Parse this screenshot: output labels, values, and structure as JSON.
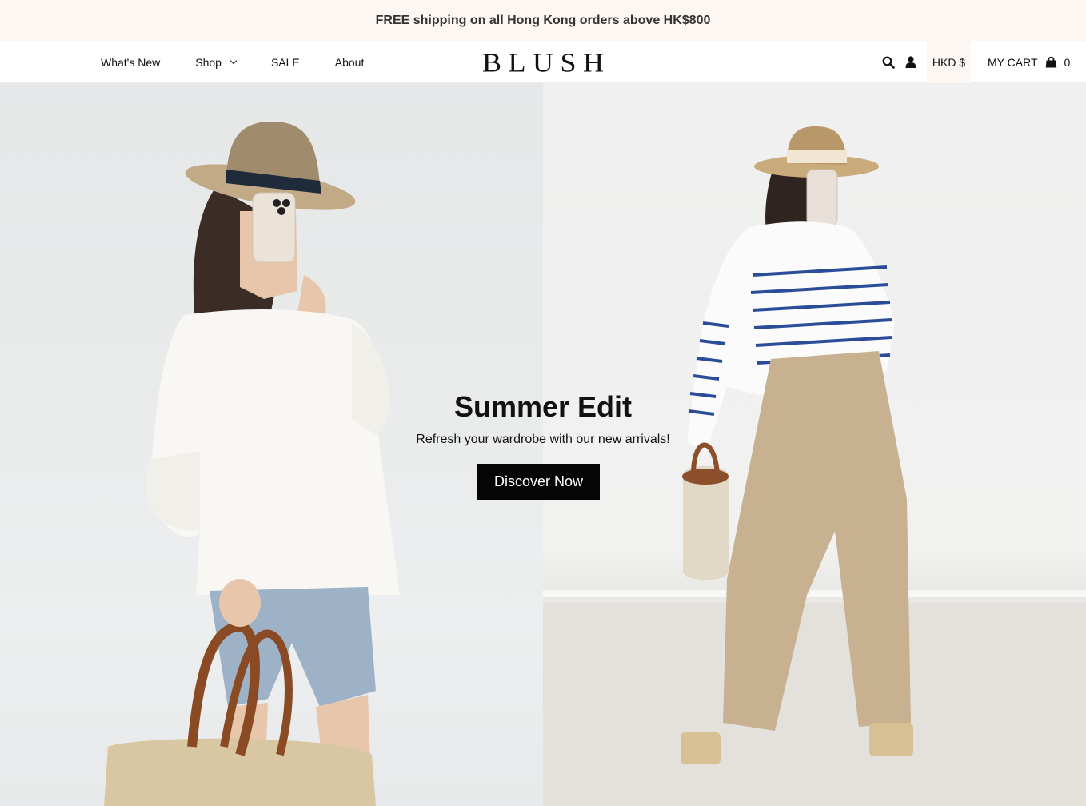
{
  "announcement": {
    "text": "FREE shipping on all Hong Kong orders above HK$800"
  },
  "nav": {
    "links": [
      {
        "label": "What's New"
      },
      {
        "label": "Shop",
        "has_dropdown": true
      },
      {
        "label": "SALE"
      },
      {
        "label": "About"
      }
    ],
    "logo": {
      "letters": [
        "B",
        "L",
        "U",
        "S",
        "H"
      ]
    },
    "icons": {
      "search": "search-icon",
      "account": "user-icon",
      "cart": "shopping-bag-icon"
    },
    "currency": "HKD $",
    "cart_label": "MY CART",
    "cart_count": "0"
  },
  "hero": {
    "title": "Summer Edit",
    "subtitle": "Refresh your wardrobe with our new arrivals!",
    "cta_label": "Discover Now"
  },
  "colors": {
    "announcement_bg": "#fcf7f3",
    "button_bg": "#050505",
    "text": "#111111"
  }
}
